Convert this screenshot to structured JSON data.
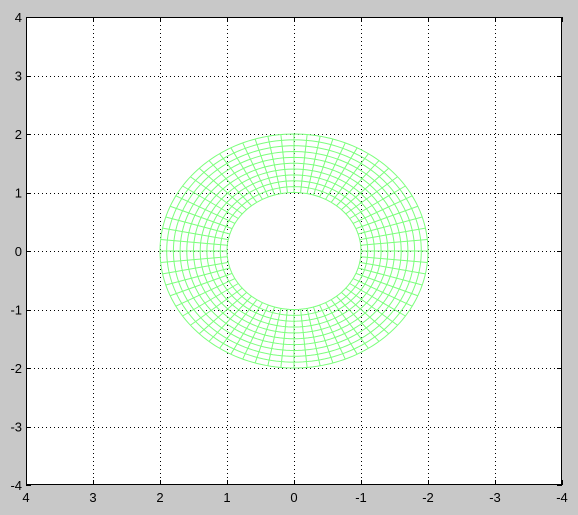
{
  "window": {
    "background_color": "#c8c8c8"
  },
  "chart_data": {
    "type": "mesh",
    "title": "",
    "xlabel": "",
    "ylabel": "",
    "xlim": [
      4,
      -4
    ],
    "ylim": [
      -4,
      4
    ],
    "x_reversed": true,
    "grid": true,
    "grid_style": "dotted",
    "x_ticks": [
      4,
      3,
      2,
      1,
      0,
      -1,
      -2,
      -3,
      -4
    ],
    "y_ticks": [
      4,
      3,
      2,
      1,
      0,
      -1,
      -2,
      -3,
      -4
    ],
    "x_tick_labels": [
      "4",
      "3",
      "2",
      "1",
      "0",
      "-1",
      "-2",
      "-3",
      "-4"
    ],
    "y_tick_labels": [
      "4",
      "3",
      "2",
      "1",
      "0",
      "-1",
      "-2",
      "-3",
      "-4"
    ],
    "series": [
      {
        "shape": "annulus-mesh",
        "center": [
          0,
          0
        ],
        "inner_radius": 1,
        "outer_radius": 2,
        "x_scale": 1,
        "y_scale": 1,
        "radial_divisions": 10,
        "angular_divisions": 64,
        "color": "#7cff7c"
      }
    ],
    "axes_background": "#ffffff",
    "axes_color": "#000000"
  }
}
